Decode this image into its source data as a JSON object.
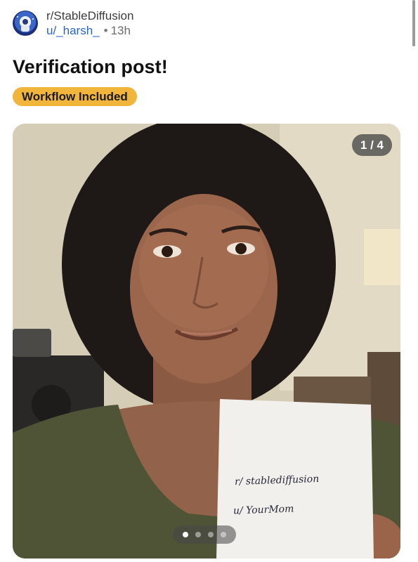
{
  "post": {
    "subreddit": "r/StableDiffusion",
    "author": "u/_harsh_",
    "separator": "•",
    "age": "13h",
    "title": "Verification post!",
    "flair": "Workflow Included",
    "flair_color": "#f2b53c"
  },
  "media": {
    "counter": "1 / 4",
    "current_index": 1,
    "total": 4,
    "note_line1": "r/ stablediffusion",
    "note_line2": "u/ YourMom"
  },
  "colors": {
    "author_link": "#2b64c9",
    "title": "#111111",
    "background": "#ffffff"
  },
  "icons": {
    "avatar": "subreddit-avatar-icon"
  }
}
